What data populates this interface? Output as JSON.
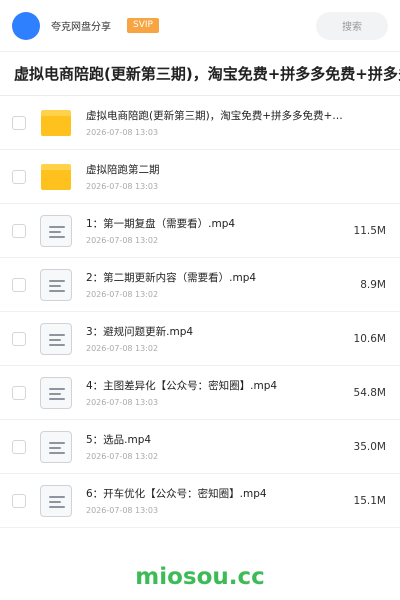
{
  "header": {
    "user_name": "夸克网盘分享",
    "badge": "SVIP",
    "search_label": "搜索"
  },
  "page_title": "虚拟电商陪跑(更新第三期)，淘宝免费+拼多多免费+拼多多",
  "files": [
    {
      "type": "folder",
      "name": "虚拟电商陪跑(更新第三期)，淘宝免费+拼多多免费+…",
      "date": "2026-07-08 13:03",
      "size": ""
    },
    {
      "type": "folder",
      "name": "虚拟陪跑第二期",
      "date": "2026-07-08 13:03",
      "size": ""
    },
    {
      "type": "video",
      "name": "1：第一期复盘（需要看）.mp4",
      "date": "2026-07-08 13:02",
      "size": "11.5M"
    },
    {
      "type": "video",
      "name": "2：第二期更新内容（需要看）.mp4",
      "date": "2026-07-08 13:02",
      "size": "8.9M"
    },
    {
      "type": "video",
      "name": "3：避规问题更新.mp4",
      "date": "2026-07-08 13:02",
      "size": "10.6M"
    },
    {
      "type": "video",
      "name": "4：主图差异化【公众号：密知圈】.mp4",
      "date": "2026-07-08 13:03",
      "size": "54.8M"
    },
    {
      "type": "video",
      "name": "5：选品.mp4",
      "date": "2026-07-08 13:02",
      "size": "35.0M"
    },
    {
      "type": "video",
      "name": "6：开车优化【公众号：密知圈】.mp4",
      "date": "2026-07-08 13:03",
      "size": "15.1M"
    }
  ],
  "watermark": "miosou.cc",
  "colors": {
    "avatar": "#2f80ff",
    "svip_badge": "#f7a442",
    "folder": "#ffc11e",
    "watermark": "#3cbb57"
  }
}
